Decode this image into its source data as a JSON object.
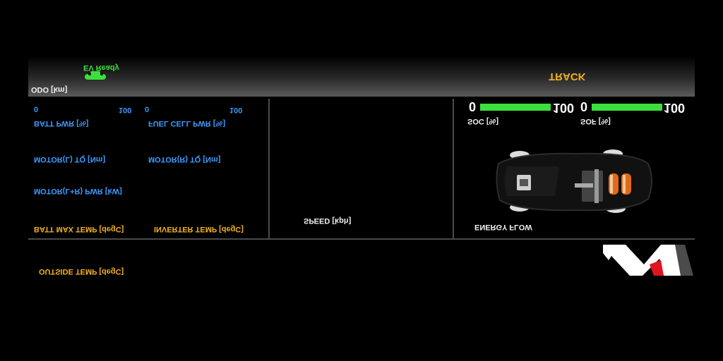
{
  "header": {
    "odo_label": "ODO [km]",
    "ev_ready": "EV Ready",
    "mode": "TRACK"
  },
  "left_panel": {
    "batt_pwr": {
      "label": "BATT PWR [%]",
      "min": "0",
      "max": "100"
    },
    "fuel_cell_pwr": {
      "label": "FUEL CELL PWR [%]",
      "min": "0",
      "max": "100"
    },
    "motor_l_tq": "MOTOR(L) TQ [Nm]",
    "motor_r_tq": "MOTOR(R) TQ [Nm]",
    "motor_lr_pwr": "MOTOR(L+R) PWR [kW]",
    "batt_max_temp": "BATT MAX TEMP [degC]",
    "inverter_temp": "INVERTER TEMP [degC]"
  },
  "center_panel": {
    "speed_label": "SPEED [kph]"
  },
  "right_panel": {
    "soc": {
      "label": "SOC [%]",
      "min": "0",
      "max": "100",
      "level": 100
    },
    "sof": {
      "label": "SOF [%]",
      "min": "0",
      "max": "100",
      "level": 100
    },
    "energy_flow_label": "ENERGY FLOW"
  },
  "footer": {
    "outside_temp": "OUTSIDE TEMP [degC]"
  },
  "colors": {
    "accent_blue": "#3d9bff",
    "accent_yellow": "#f2b01e",
    "ev_green": "#3be03b",
    "logo_red": "#e0141e"
  }
}
